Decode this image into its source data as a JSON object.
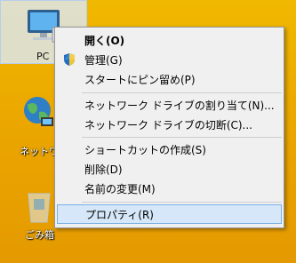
{
  "desktop": {
    "icons": [
      {
        "label": "PC"
      },
      {
        "label": "ネットワーク"
      },
      {
        "label": "ごみ箱"
      }
    ]
  },
  "context_menu": {
    "items": [
      {
        "label": "開く(O)",
        "bold": true
      },
      {
        "label": "管理(G)",
        "icon": "shield-icon"
      },
      {
        "label": "スタートにピン留め(P)"
      },
      {
        "label": "ネットワーク ドライブの割り当て(N)..."
      },
      {
        "label": "ネットワーク ドライブの切断(C)..."
      },
      {
        "label": "ショートカットの作成(S)"
      },
      {
        "label": "削除(D)"
      },
      {
        "label": "名前の変更(M)"
      },
      {
        "label": "プロパティ(R)",
        "highlighted": true
      }
    ]
  }
}
